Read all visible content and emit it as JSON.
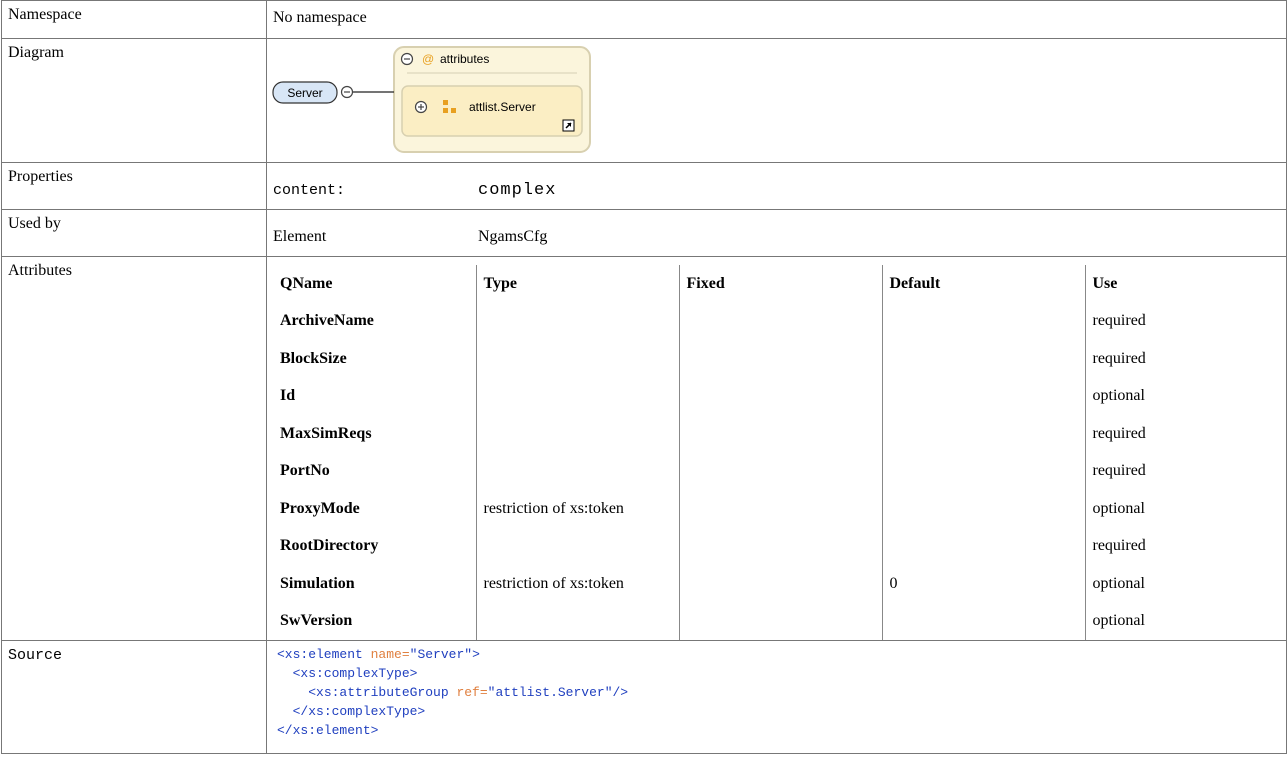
{
  "labels": {
    "namespace": "Namespace",
    "diagram": "Diagram",
    "properties": "Properties",
    "used_by": "Used by",
    "attributes": "Attributes",
    "source": "Source"
  },
  "namespace_value": "No namespace",
  "diagram": {
    "element": "Server",
    "group_title": "attributes",
    "group_ref": "attlist.Server"
  },
  "properties": {
    "key": "content:",
    "value": "complex"
  },
  "used_by": {
    "kind": "Element",
    "name": "NgamsCfg"
  },
  "attributes_table": {
    "headers": [
      "QName",
      "Type",
      "Fixed",
      "Default",
      "Use"
    ],
    "rows": [
      {
        "qname": "ArchiveName",
        "type": "",
        "fixed": "",
        "default": "",
        "use": "required"
      },
      {
        "qname": "BlockSize",
        "type": "",
        "fixed": "",
        "default": "",
        "use": "required"
      },
      {
        "qname": "Id",
        "type": "",
        "fixed": "",
        "default": "",
        "use": "optional"
      },
      {
        "qname": "MaxSimReqs",
        "type": "",
        "fixed": "",
        "default": "",
        "use": "required"
      },
      {
        "qname": "PortNo",
        "type": "",
        "fixed": "",
        "default": "",
        "use": "required"
      },
      {
        "qname": "ProxyMode",
        "type": "restriction of xs:token",
        "fixed": "",
        "default": "",
        "use": "optional"
      },
      {
        "qname": "RootDirectory",
        "type": "",
        "fixed": "",
        "default": "",
        "use": "required"
      },
      {
        "qname": "Simulation",
        "type": "restriction of xs:token",
        "fixed": "",
        "default": "0",
        "use": "optional"
      },
      {
        "qname": "SwVersion",
        "type": "",
        "fixed": "",
        "default": "",
        "use": "optional"
      }
    ]
  },
  "source": {
    "l1_open": "<xs:element ",
    "l1_attr": "name=",
    "l1_val": "\"Server\"",
    "l1_close": ">",
    "l2": "<xs:complexType>",
    "l3_open": "<xs:attributeGroup ",
    "l3_attr": "ref=",
    "l3_val": "\"attlist.Server\"",
    "l3_close": "/>",
    "l4": "</xs:complexType>",
    "l5": "</xs:element>"
  },
  "colors": {
    "tag": "#1f3fbf",
    "attr_name": "#e08040",
    "group_fill": "#fbf5dc",
    "element_fill": "#d8e6f6"
  }
}
